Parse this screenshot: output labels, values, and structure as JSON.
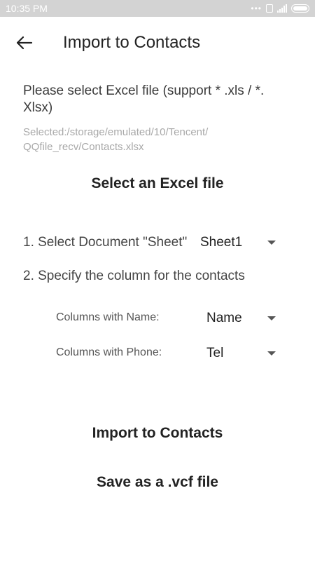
{
  "status_bar": {
    "time": "10:35 PM",
    "icons": [
      "more-dots-icon",
      "sim-icon",
      "signal-icon",
      "battery-icon"
    ]
  },
  "app_bar": {
    "back_icon": "arrow-left-icon",
    "title": "Import to Contacts"
  },
  "main": {
    "hint": "Please select Excel file (support * .xls / *. Xlsx)",
    "selected_path": "Selected:/storage/emulated/10/Tencent/ QQfile_recv/Contacts.xlsx",
    "select_file_button": "Select an Excel file",
    "step1": {
      "label": "1. Select Document \"Sheet\"",
      "selected": "Sheet1"
    },
    "step2": {
      "label": "2. Specify the column for the contacts"
    },
    "name_column": {
      "label": "Columns with Name:",
      "selected": "Name"
    },
    "phone_column": {
      "label": "Columns with Phone:",
      "selected": "Tel"
    },
    "import_button": "Import to Contacts",
    "save_vcf_button": "Save as a .vcf file"
  },
  "colors": {
    "status_bar_bg": "#d3d3d3",
    "text_primary": "#222222",
    "text_secondary": "#a8a8a8",
    "background": "#ffffff"
  }
}
